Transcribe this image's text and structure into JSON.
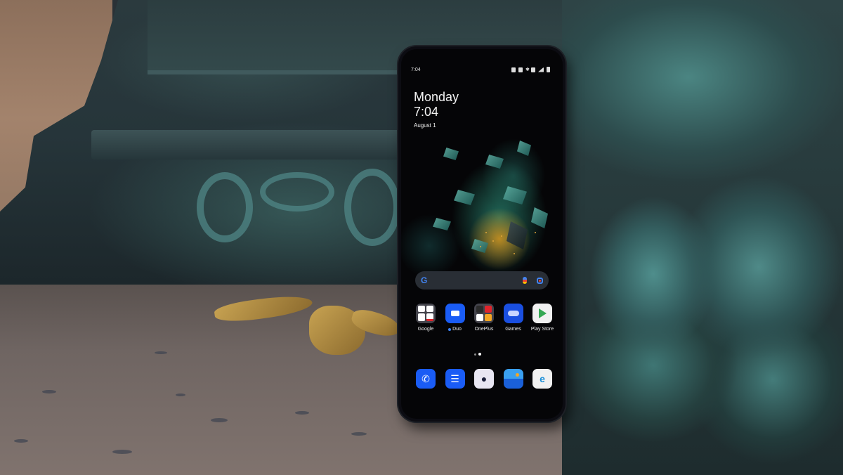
{
  "scene": {
    "description": "OnePlus smartphone standing on stone ground beside a verdigris bronze statue base",
    "colors": {
      "patina": "#4f8685",
      "ground": "#6f6562",
      "wall": "#a3836c",
      "leaf": "#c8a352"
    }
  },
  "phone": {
    "status_bar": {
      "time": "7:04",
      "icons": [
        "nfc-icon",
        "vibrate-icon",
        "bluetooth-icon",
        "data-saver-icon",
        "signal-icon",
        "battery-icon"
      ],
      "bluetooth_glyph": "✱"
    },
    "clock_widget": {
      "day": "Monday",
      "time": "7:04",
      "date": "August 1"
    },
    "search_bar": {
      "logo": "G",
      "mic": "mic-icon",
      "lens": "lens-icon"
    },
    "apps": [
      {
        "label": "Google",
        "icon": "google-folder-icon",
        "type": "folder",
        "color": "#5a5a64",
        "minis": [
          "#ffffff",
          "#ffffff",
          "#ffffff",
          "#ffffff"
        ]
      },
      {
        "label": "Duo",
        "icon": "duo-video-icon",
        "glyph": "▶",
        "color": "#1a5cf5",
        "new": true
      },
      {
        "label": "OnePlus",
        "icon": "oneplus-folder-icon",
        "type": "folder",
        "color": "#5a5a64",
        "minis": [
          "#2b2b2b",
          "#e0242b",
          "#ffffff",
          "#f5a623"
        ]
      },
      {
        "label": "Games",
        "icon": "games-controller-icon",
        "glyph": "🎮",
        "color": "#1a4fe0"
      },
      {
        "label": "Play Store",
        "icon": "play-store-icon",
        "glyph": "▶",
        "color": "#f1f1f1"
      }
    ],
    "dock": [
      {
        "label": "Phone",
        "icon": "phone-icon",
        "glyph": "✆",
        "color": "#1a5cf5"
      },
      {
        "label": "Messages",
        "icon": "messages-icon",
        "glyph": "☰",
        "color": "#1a5cf5"
      },
      {
        "label": "Camera",
        "icon": "camera-icon",
        "glyph": "●",
        "color": "#e8e6f2"
      },
      {
        "label": "Gallery",
        "icon": "gallery-icon",
        "glyph": "",
        "color": "#1a70e0"
      },
      {
        "label": "Edge",
        "icon": "edge-browser-icon",
        "glyph": "e",
        "color": "#f1f1f1"
      }
    ],
    "page_indicator": {
      "pages": 2,
      "active": 2
    }
  }
}
